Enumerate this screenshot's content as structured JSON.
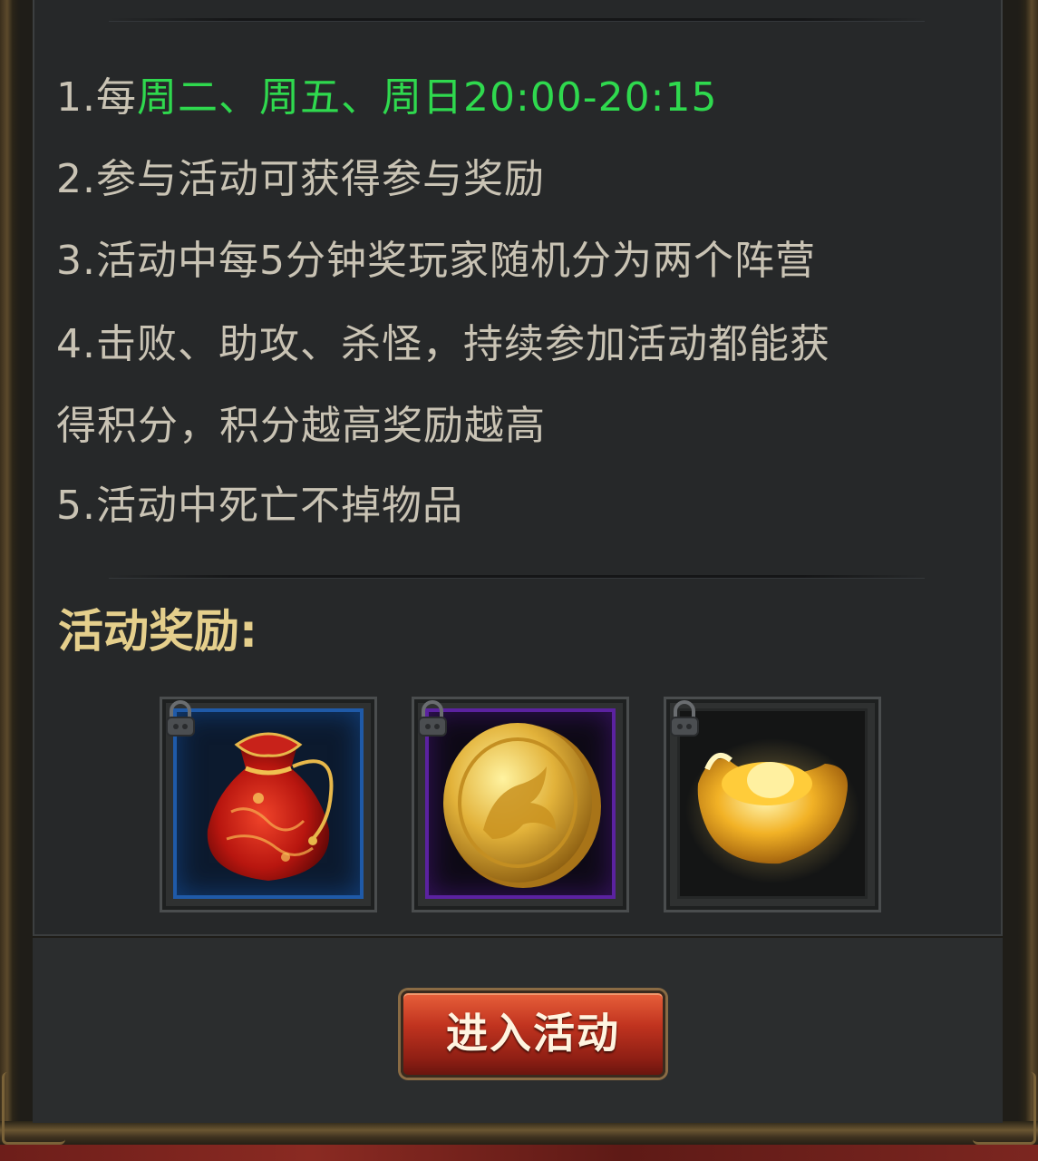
{
  "rules": {
    "r1_prefix": "1.每",
    "r1_highlight": "周二、周五、周日20:00-20:15",
    "r2": "2.参与活动可获得参与奖励",
    "r3": "3.活动中每5分钟奖玩家随机分为两个阵营",
    "r4a": "4.击败、助攻、杀怪，持续参加活动都能获",
    "r4b": "得积分，积分越高奖励越高",
    "r5": "5.活动中死亡不掉物品"
  },
  "rewards": {
    "title": "活动奖励:",
    "items": [
      {
        "icon": "red-pouch-icon",
        "rarity": "blue",
        "locked": true
      },
      {
        "icon": "gold-coin-icon",
        "rarity": "purple",
        "locked": true
      },
      {
        "icon": "gold-ingot-icon",
        "rarity": "none",
        "locked": true
      }
    ]
  },
  "button": {
    "enter_label": "进入活动"
  },
  "colors": {
    "highlight_green": "#2fd94e",
    "rule_text": "#c9c3b4",
    "title_gold": "#e5cf8c",
    "button_red": "#c0331f"
  }
}
